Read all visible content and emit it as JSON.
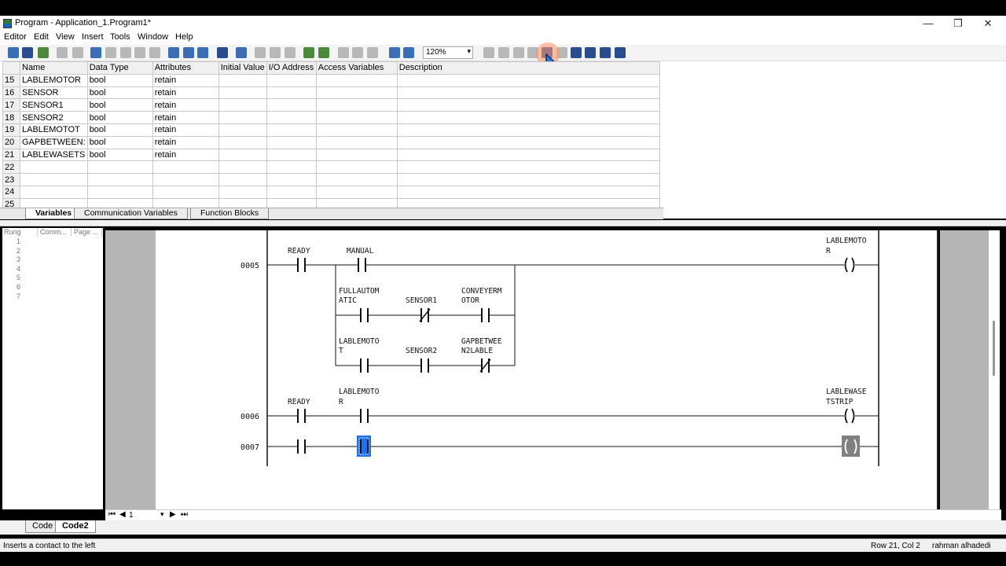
{
  "window": {
    "title": "Program - Application_1.Program1*",
    "controls": [
      "—",
      "❐",
      "✕"
    ]
  },
  "menu": [
    "Editor",
    "Edit",
    "View",
    "Insert",
    "Tools",
    "Window",
    "Help"
  ],
  "toolbar": {
    "zoom": "120%"
  },
  "variables": {
    "columns": [
      "Name",
      "Data Type",
      "Attributes",
      "Initial Value",
      "I/O Address",
      "Access Variables",
      "Description"
    ],
    "rows": [
      {
        "num": "15",
        "name": "LABLEMOTOR",
        "type": "bool",
        "attr": "retain"
      },
      {
        "num": "16",
        "name": "SENSOR",
        "type": "bool",
        "attr": "retain"
      },
      {
        "num": "17",
        "name": "SENSOR1",
        "type": "bool",
        "attr": "retain"
      },
      {
        "num": "18",
        "name": "SENSOR2",
        "type": "bool",
        "attr": "retain"
      },
      {
        "num": "19",
        "name": "LABLEMOTOT",
        "type": "bool",
        "attr": "retain"
      },
      {
        "num": "20",
        "name": "GAPBETWEEN:",
        "type": "bool",
        "attr": "retain"
      },
      {
        "num": "21",
        "name": "LABLEWASETS",
        "type": "bool",
        "attr": "retain"
      },
      {
        "num": "22",
        "name": "",
        "type": "",
        "attr": ""
      },
      {
        "num": "23",
        "name": "",
        "type": "",
        "attr": ""
      },
      {
        "num": "24",
        "name": "",
        "type": "",
        "attr": ""
      },
      {
        "num": "25",
        "name": "",
        "type": "",
        "attr": ""
      }
    ],
    "tabs": [
      "Variables",
      "Communication Variables",
      "Function Blocks"
    ]
  },
  "rung_panel": {
    "headers": [
      "Rung",
      "Comm...",
      "Page ..."
    ],
    "numbers": [
      "1",
      "2",
      "3",
      "4",
      "5",
      "6",
      "7"
    ]
  },
  "ladder": {
    "rungs": [
      "0005",
      "0006",
      "0007"
    ],
    "labels": {
      "r5_c1": "READY",
      "r5_c2": "MANUAL",
      "r5_coil_a": "LABLEMOTO",
      "r5_coil_b": "R",
      "b1_c1_a": "FULLAUTOM",
      "b1_c1_b": "ATIC",
      "b1_c2": "SENSOR1",
      "b1_c3_a": "CONVEYERM",
      "b1_c3_b": "OTOR",
      "b2_c1_a": "LABLEMOTO",
      "b2_c1_b": "T",
      "b2_c2": "SENSOR2",
      "b2_c3_a": "GAPBETWEE",
      "b2_c3_b": "N2LABLE",
      "r6_c1": "READY",
      "r6_c2_a": "LABLEMOTO",
      "r6_c2_b": "R",
      "r6_coil_a": "LABLEWASE",
      "r6_coil_b": "TSTRIP"
    }
  },
  "page_nav": {
    "page": "1"
  },
  "code_tabs": [
    "Code",
    "Code2"
  ],
  "status": {
    "hint": "Inserts a contact to the left",
    "position": "Row 21, Col 2",
    "user": "rahman alhadedi"
  }
}
